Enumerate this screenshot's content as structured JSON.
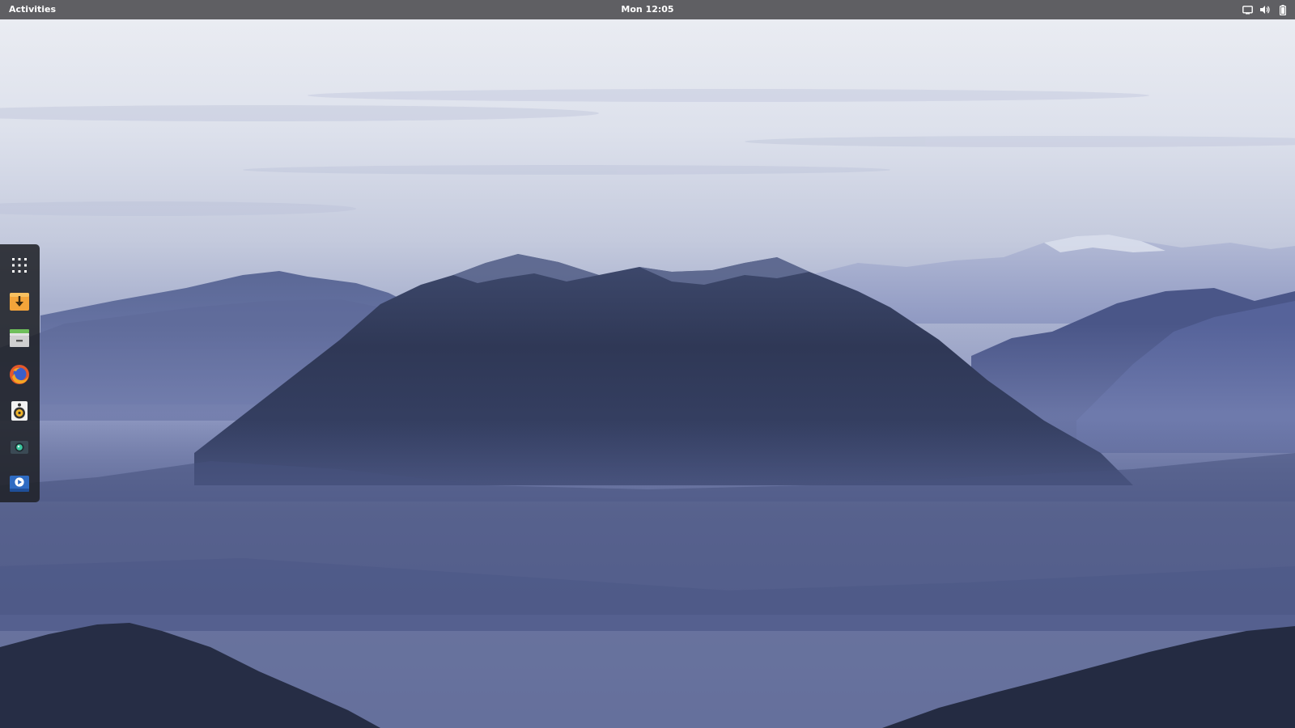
{
  "topbar": {
    "activities_label": "Activities",
    "clock": "Mon 12:05",
    "tray_icons": [
      "display-icon",
      "volume-icon",
      "battery-icon"
    ]
  },
  "dock": {
    "items": [
      {
        "icon": "app-grid-icon"
      },
      {
        "icon": "software-download-icon"
      },
      {
        "icon": "file-manager-icon"
      },
      {
        "icon": "firefox-icon"
      },
      {
        "icon": "rhythmbox-speaker-icon"
      },
      {
        "icon": "cheese-camera-icon"
      },
      {
        "icon": "video-player-icon"
      }
    ]
  },
  "colors": {
    "topbar_bg": "#5f5f63",
    "dock_bg": "#202228",
    "text": "#ffffff"
  }
}
